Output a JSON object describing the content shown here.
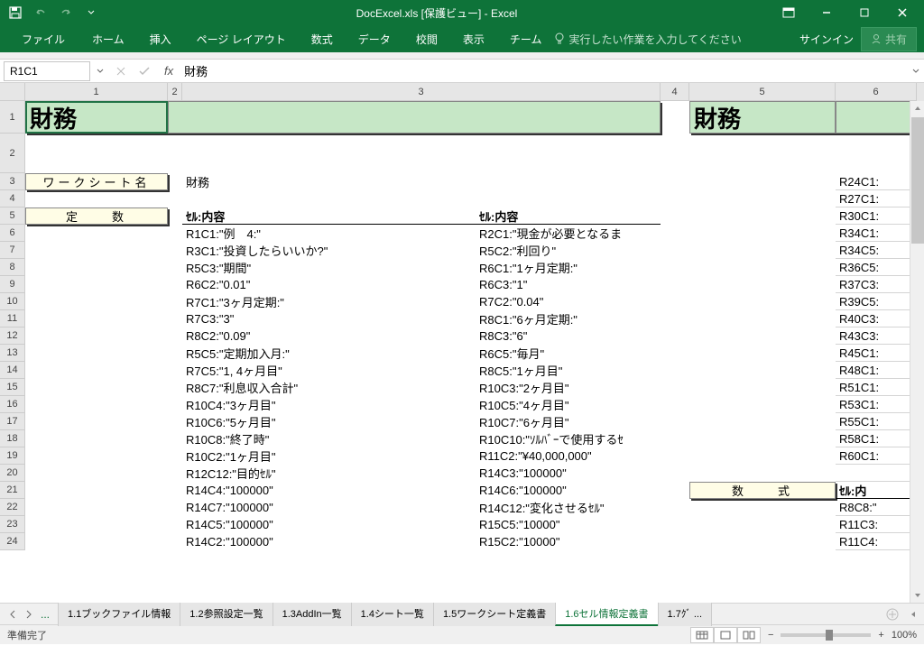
{
  "title": "DocExcel.xls  [保護ビュー] - Excel",
  "qat": {
    "save": "保存"
  },
  "ribbon": {
    "tabs": [
      "ファイル",
      "ホーム",
      "挿入",
      "ページ レイアウト",
      "数式",
      "データ",
      "校閲",
      "表示",
      "チーム"
    ],
    "tellme": "実行したい作業を入力してください",
    "signin": "サインイン",
    "share": "共有"
  },
  "namebox": "R1C1",
  "formula": "財務",
  "columns": [
    "1",
    "2",
    "3",
    "4",
    "5",
    "6"
  ],
  "row_labels": [
    "1",
    "2",
    "3",
    "4",
    "5",
    "6",
    "7",
    "8",
    "9",
    "10",
    "11",
    "12",
    "13",
    "14",
    "15",
    "16",
    "17",
    "18",
    "19",
    "20",
    "21",
    "22",
    "23",
    "24"
  ],
  "cells": {
    "title_left": "財務",
    "title_right": "財務",
    "worksheet_label": "ワークシート名",
    "worksheet_value": "財務",
    "const_label": "定　　数",
    "formula_label": "数　　式",
    "hdr_left": "ｾﾙ:内容",
    "hdr_right": "ｾﾙ:内容",
    "col6_hdr": "ｾﾙ:内"
  },
  "rows3": [
    {
      "a": "R1C1:\"例　4:\"",
      "b": "R2C1:\"現金が必要となるま"
    },
    {
      "a": "R3C1:\"投資したらいいか?\"",
      "b": "R5C2:\"利回り\""
    },
    {
      "a": "R5C3:\"期間\"",
      "b": "R6C1:\"1ヶ月定期:\""
    },
    {
      "a": "R6C2:\"0.01\"",
      "b": "R6C3:\"1\""
    },
    {
      "a": "R7C1:\"3ヶ月定期:\"",
      "b": "R7C2:\"0.04\""
    },
    {
      "a": "R7C3:\"3\"",
      "b": "R8C1:\"6ヶ月定期:\""
    },
    {
      "a": "R8C2:\"0.09\"",
      "b": "R8C3:\"6\""
    },
    {
      "a": "R5C5:\"定期加入月:\"",
      "b": "R6C5:\"毎月\""
    },
    {
      "a": "R7C5:\"1, 4ヶ月目\"",
      "b": "R8C5:\"1ヶ月目\""
    },
    {
      "a": "R8C7:\"利息収入合計\"",
      "b": "R10C3:\"2ヶ月目\""
    },
    {
      "a": "R10C4:\"3ヶ月目\"",
      "b": "R10C5:\"4ヶ月目\""
    },
    {
      "a": "R10C6:\"5ヶ月目\"",
      "b": "R10C7:\"6ヶ月目\""
    },
    {
      "a": "R10C8:\"終了時\"",
      "b": "R10C10:\"ｿﾙﾊﾞｰで使用するｾ"
    },
    {
      "a": "R10C2:\"1ヶ月目\"",
      "b": "R11C2:\"¥40,000,000\""
    },
    {
      "a": "R12C12:\"目的ｾﾙ\"",
      "b": "R14C3:\"100000\""
    },
    {
      "a": "R14C4:\"100000\"",
      "b": "R14C6:\"100000\""
    },
    {
      "a": "R14C7:\"100000\"",
      "b": "R14C12:\"変化させるｾﾙ\""
    },
    {
      "a": "R14C5:\"100000\"",
      "b": "R15C5:\"10000\""
    },
    {
      "a": "R14C2:\"100000\"",
      "b": "R15C2:\"10000\""
    }
  ],
  "col6_rows": [
    "R24C1:",
    "R27C1:",
    "R30C1:",
    "R34C1:",
    "R34C5:",
    "R36C5:",
    "R37C3:",
    "R39C5:",
    "R40C3:",
    "R43C3:",
    "R45C1:",
    "R48C1:",
    "R51C1:",
    "R53C1:",
    "R55C1:",
    "R58C1:",
    "R60C1:",
    "",
    "",
    "R8C8:\"",
    "R11C3:",
    "R11C4:"
  ],
  "sheet_nav_dots": "...",
  "tabs": [
    {
      "label": "1.1ブックファイル情報",
      "active": false
    },
    {
      "label": "1.2参照設定一覧",
      "active": false
    },
    {
      "label": "1.3AddIn一覧",
      "active": false
    },
    {
      "label": "1.4シート一覧",
      "active": false
    },
    {
      "label": "1.5ワークシート定義書",
      "active": false
    },
    {
      "label": "1.6セル情報定義書",
      "active": true
    },
    {
      "label": "1.7ｸﾞ ...",
      "active": false
    }
  ],
  "status": {
    "ready": "準備完了",
    "zoom": "100%"
  },
  "chart_data": null
}
